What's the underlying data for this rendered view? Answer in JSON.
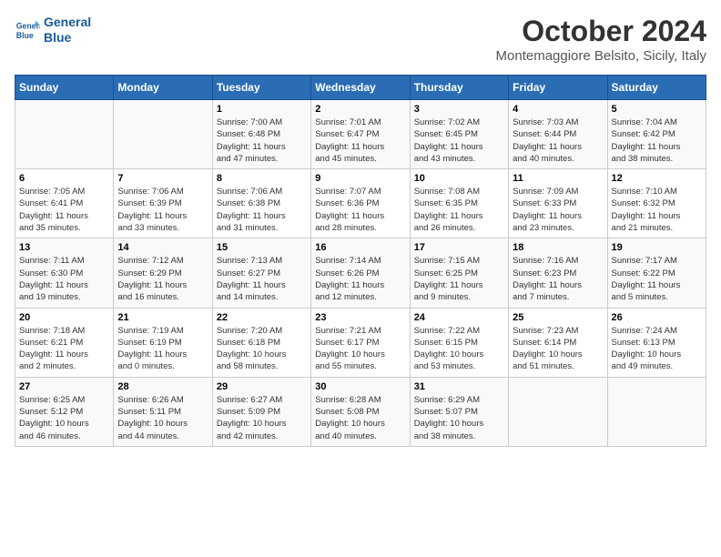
{
  "logo": {
    "line1": "General",
    "line2": "Blue"
  },
  "title": "October 2024",
  "subtitle": "Montemaggiore Belsito, Sicily, Italy",
  "days_of_week": [
    "Sunday",
    "Monday",
    "Tuesday",
    "Wednesday",
    "Thursday",
    "Friday",
    "Saturday"
  ],
  "weeks": [
    [
      {
        "day": "",
        "detail": ""
      },
      {
        "day": "",
        "detail": ""
      },
      {
        "day": "1",
        "detail": "Sunrise: 7:00 AM\nSunset: 6:48 PM\nDaylight: 11 hours\nand 47 minutes."
      },
      {
        "day": "2",
        "detail": "Sunrise: 7:01 AM\nSunset: 6:47 PM\nDaylight: 11 hours\nand 45 minutes."
      },
      {
        "day": "3",
        "detail": "Sunrise: 7:02 AM\nSunset: 6:45 PM\nDaylight: 11 hours\nand 43 minutes."
      },
      {
        "day": "4",
        "detail": "Sunrise: 7:03 AM\nSunset: 6:44 PM\nDaylight: 11 hours\nand 40 minutes."
      },
      {
        "day": "5",
        "detail": "Sunrise: 7:04 AM\nSunset: 6:42 PM\nDaylight: 11 hours\nand 38 minutes."
      }
    ],
    [
      {
        "day": "6",
        "detail": "Sunrise: 7:05 AM\nSunset: 6:41 PM\nDaylight: 11 hours\nand 35 minutes."
      },
      {
        "day": "7",
        "detail": "Sunrise: 7:06 AM\nSunset: 6:39 PM\nDaylight: 11 hours\nand 33 minutes."
      },
      {
        "day": "8",
        "detail": "Sunrise: 7:06 AM\nSunset: 6:38 PM\nDaylight: 11 hours\nand 31 minutes."
      },
      {
        "day": "9",
        "detail": "Sunrise: 7:07 AM\nSunset: 6:36 PM\nDaylight: 11 hours\nand 28 minutes."
      },
      {
        "day": "10",
        "detail": "Sunrise: 7:08 AM\nSunset: 6:35 PM\nDaylight: 11 hours\nand 26 minutes."
      },
      {
        "day": "11",
        "detail": "Sunrise: 7:09 AM\nSunset: 6:33 PM\nDaylight: 11 hours\nand 23 minutes."
      },
      {
        "day": "12",
        "detail": "Sunrise: 7:10 AM\nSunset: 6:32 PM\nDaylight: 11 hours\nand 21 minutes."
      }
    ],
    [
      {
        "day": "13",
        "detail": "Sunrise: 7:11 AM\nSunset: 6:30 PM\nDaylight: 11 hours\nand 19 minutes."
      },
      {
        "day": "14",
        "detail": "Sunrise: 7:12 AM\nSunset: 6:29 PM\nDaylight: 11 hours\nand 16 minutes."
      },
      {
        "day": "15",
        "detail": "Sunrise: 7:13 AM\nSunset: 6:27 PM\nDaylight: 11 hours\nand 14 minutes."
      },
      {
        "day": "16",
        "detail": "Sunrise: 7:14 AM\nSunset: 6:26 PM\nDaylight: 11 hours\nand 12 minutes."
      },
      {
        "day": "17",
        "detail": "Sunrise: 7:15 AM\nSunset: 6:25 PM\nDaylight: 11 hours\nand 9 minutes."
      },
      {
        "day": "18",
        "detail": "Sunrise: 7:16 AM\nSunset: 6:23 PM\nDaylight: 11 hours\nand 7 minutes."
      },
      {
        "day": "19",
        "detail": "Sunrise: 7:17 AM\nSunset: 6:22 PM\nDaylight: 11 hours\nand 5 minutes."
      }
    ],
    [
      {
        "day": "20",
        "detail": "Sunrise: 7:18 AM\nSunset: 6:21 PM\nDaylight: 11 hours\nand 2 minutes."
      },
      {
        "day": "21",
        "detail": "Sunrise: 7:19 AM\nSunset: 6:19 PM\nDaylight: 11 hours\nand 0 minutes."
      },
      {
        "day": "22",
        "detail": "Sunrise: 7:20 AM\nSunset: 6:18 PM\nDaylight: 10 hours\nand 58 minutes."
      },
      {
        "day": "23",
        "detail": "Sunrise: 7:21 AM\nSunset: 6:17 PM\nDaylight: 10 hours\nand 55 minutes."
      },
      {
        "day": "24",
        "detail": "Sunrise: 7:22 AM\nSunset: 6:15 PM\nDaylight: 10 hours\nand 53 minutes."
      },
      {
        "day": "25",
        "detail": "Sunrise: 7:23 AM\nSunset: 6:14 PM\nDaylight: 10 hours\nand 51 minutes."
      },
      {
        "day": "26",
        "detail": "Sunrise: 7:24 AM\nSunset: 6:13 PM\nDaylight: 10 hours\nand 49 minutes."
      }
    ],
    [
      {
        "day": "27",
        "detail": "Sunrise: 6:25 AM\nSunset: 5:12 PM\nDaylight: 10 hours\nand 46 minutes."
      },
      {
        "day": "28",
        "detail": "Sunrise: 6:26 AM\nSunset: 5:11 PM\nDaylight: 10 hours\nand 44 minutes."
      },
      {
        "day": "29",
        "detail": "Sunrise: 6:27 AM\nSunset: 5:09 PM\nDaylight: 10 hours\nand 42 minutes."
      },
      {
        "day": "30",
        "detail": "Sunrise: 6:28 AM\nSunset: 5:08 PM\nDaylight: 10 hours\nand 40 minutes."
      },
      {
        "day": "31",
        "detail": "Sunrise: 6:29 AM\nSunset: 5:07 PM\nDaylight: 10 hours\nand 38 minutes."
      },
      {
        "day": "",
        "detail": ""
      },
      {
        "day": "",
        "detail": ""
      }
    ]
  ]
}
